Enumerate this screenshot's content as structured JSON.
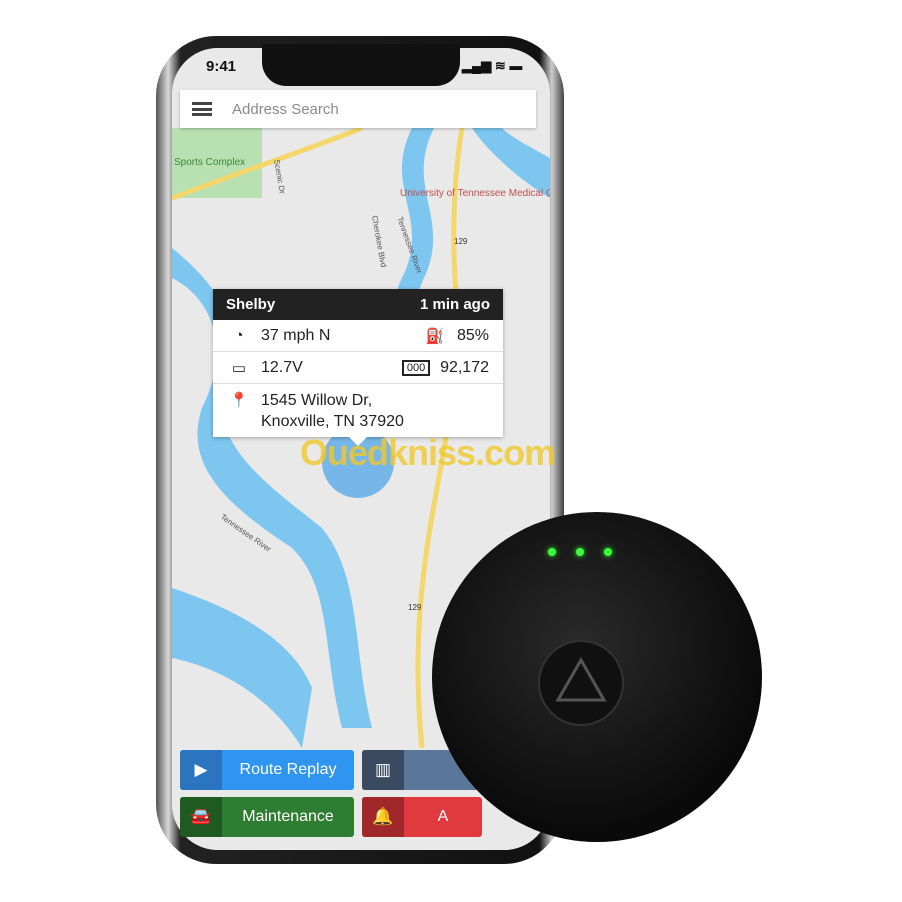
{
  "status_bar": {
    "time": "9:41",
    "signal": "▂▄▆ ≋ ▬"
  },
  "search": {
    "placeholder": "Address Search"
  },
  "map": {
    "labels": [
      "Sports Complex",
      "University of Tennessee Medical Center",
      "Tennessee River",
      "Tennessee River",
      "Scenic Dr",
      "Cherokee Blvd",
      "129",
      "129"
    ]
  },
  "popup": {
    "name": "Shelby",
    "time": "1 min ago",
    "speed": "37 mph N",
    "fuel": "85%",
    "voltage": "12.7V",
    "odometer": "92,172",
    "address_line1": "1545 Willow Dr,",
    "address_line2": "Knoxville, TN 37920"
  },
  "buttons": [
    {
      "label": "Route Replay",
      "icon": "play-icon",
      "color": "#2f95f0",
      "icon_bg": "#2a74c0"
    },
    {
      "label": "",
      "icon": "fence-icon",
      "color": "#5a7799",
      "icon_bg": "#3a4a60"
    },
    {
      "label": "Maintenance",
      "icon": "car-wrench-icon",
      "color": "#2e7d32",
      "icon_bg": "#1e5a22"
    },
    {
      "label": "A",
      "icon": "bell-icon",
      "color": "#e03a3e",
      "icon_bg": "#a0272a"
    }
  ],
  "watermark": "Ouedkniss.com"
}
